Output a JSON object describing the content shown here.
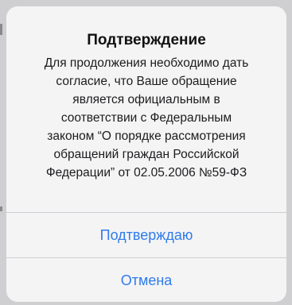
{
  "alert": {
    "title": "Подтверждение",
    "message_lines": [
      "Для продолжения необходимо дать",
      "согласие, что Ваше обращение",
      "является официальным в",
      "соответствии с Федеральным",
      "законом “О порядке рассмотрения",
      "обращений граждан Российской",
      "Федерации” от 02.05.2006 №59-ФЗ"
    ],
    "confirm_label": "Подтверждаю",
    "cancel_label": "Отмена"
  },
  "colors": {
    "accent": "#2f7bea",
    "alert_background": "#f4f4f5",
    "text": "#111111"
  }
}
